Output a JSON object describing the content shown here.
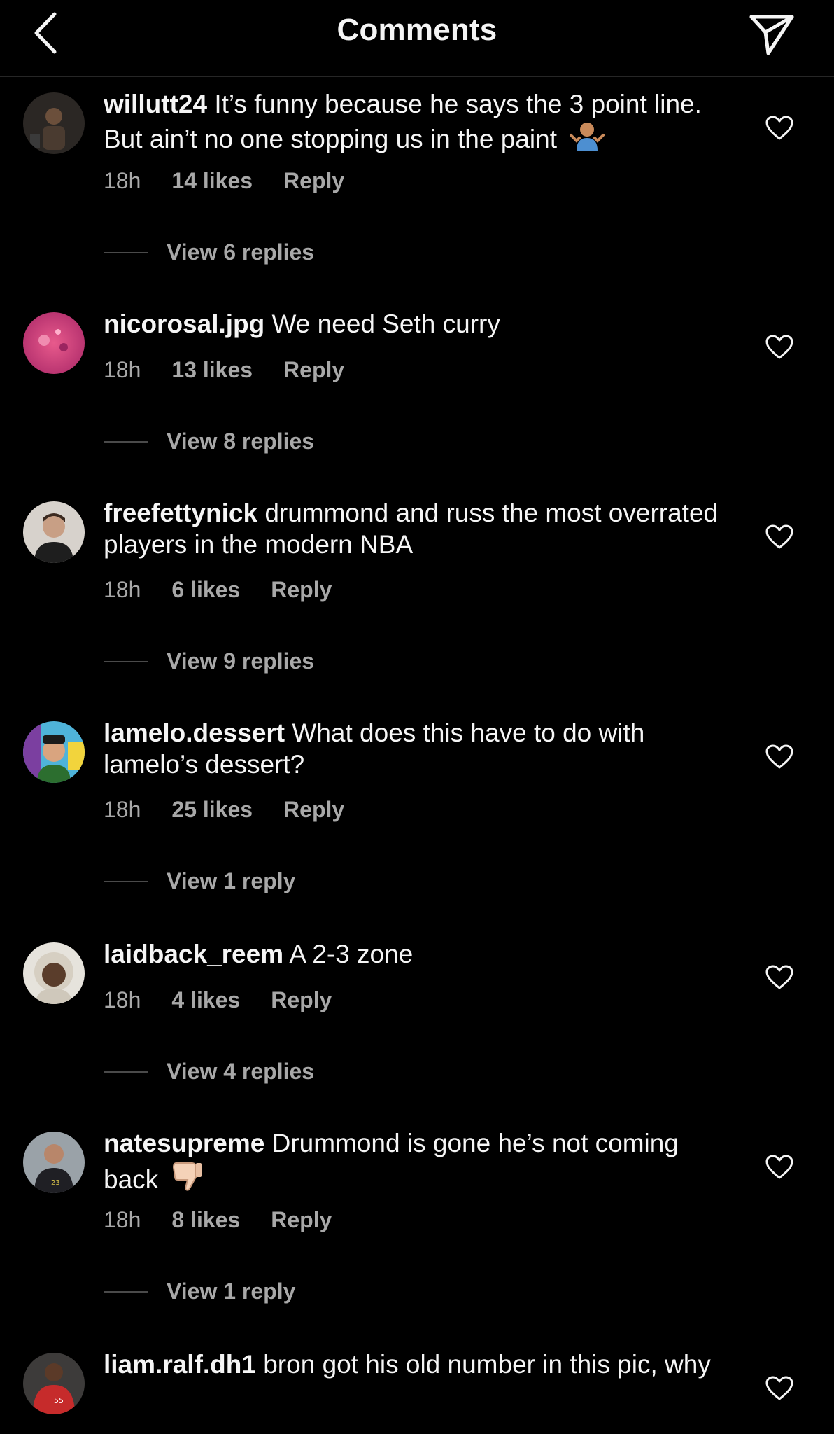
{
  "header": {
    "title": "Comments",
    "back_icon": "chevron-left-icon",
    "share_icon": "paper-plane-icon"
  },
  "comments": [
    {
      "username": "willutt24",
      "text": "It’s funny because he says the 3 point line. But ain’t no one stopping us in the paint",
      "emoji": "person-shrugging-emoji",
      "time": "18h",
      "likes": "14 likes",
      "reply": "Reply",
      "view_replies": "View 6 replies"
    },
    {
      "username": "nicorosal.jpg",
      "text": "We need Seth curry",
      "time": "18h",
      "likes": "13 likes",
      "reply": "Reply",
      "view_replies": "View 8 replies"
    },
    {
      "username": "freefettynick",
      "text": "drummond and russ the most overrated players in the modern NBA",
      "time": "18h",
      "likes": "6 likes",
      "reply": "Reply",
      "view_replies": "View 9 replies"
    },
    {
      "username": "lamelo.dessert",
      "text": "What does this have to do with lamelo’s dessert?",
      "time": "18h",
      "likes": "25 likes",
      "reply": "Reply",
      "view_replies": "View 1 reply"
    },
    {
      "username": "laidback_reem",
      "text": "A 2-3 zone",
      "time": "18h",
      "likes": "4 likes",
      "reply": "Reply",
      "view_replies": "View 4 replies"
    },
    {
      "username": "natesupreme",
      "text": "Drummond is gone he’s not coming back",
      "emoji": "thumbs-down-emoji",
      "time": "18h",
      "likes": "8 likes",
      "reply": "Reply",
      "view_replies": "View 1 reply"
    },
    {
      "username": "liam.ralf.dh1",
      "text": "bron got his old number in this pic, why"
    }
  ],
  "colors": {
    "background": "#000000",
    "primary_text": "#f5f5f5",
    "secondary_text": "#a8a8a8"
  }
}
